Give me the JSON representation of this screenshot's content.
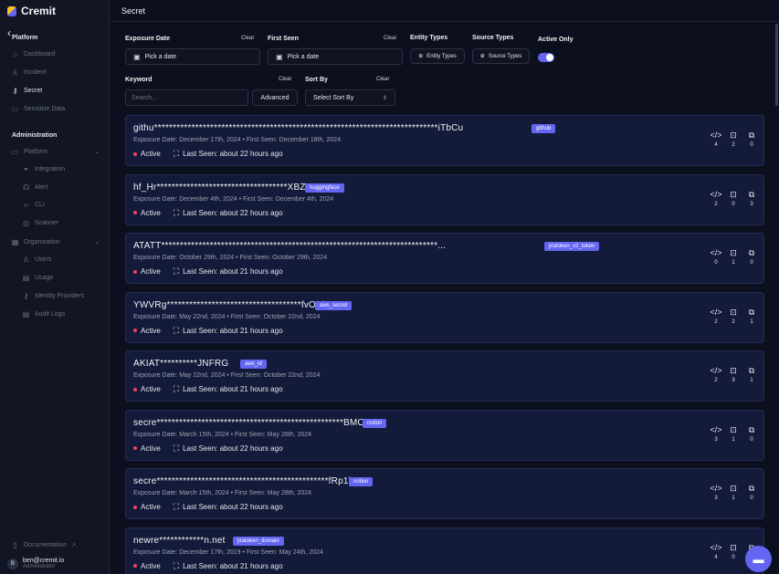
{
  "app": {
    "name": "Cremit",
    "collapse_icon": "chevron-left-icon"
  },
  "sidebar": {
    "platform_title": "Platform",
    "platform_items": [
      {
        "label": "Dashboard",
        "icon": "home-icon"
      },
      {
        "label": "Incident",
        "icon": "bell-icon"
      },
      {
        "label": "Secret",
        "icon": "key-icon",
        "active": true
      },
      {
        "label": "Sensitive Data",
        "icon": "database-icon"
      }
    ],
    "admin_title": "Administration",
    "admin_items": [
      {
        "label": "Platform",
        "icon": "monitor-icon",
        "expandable": true
      },
      {
        "label": "Integration",
        "icon": "link-icon",
        "sub": true
      },
      {
        "label": "Alert",
        "icon": "alert-icon",
        "sub": true
      },
      {
        "label": "CLI",
        "icon": "code-icon",
        "sub": true
      },
      {
        "label": "Scanner",
        "icon": "scanner-icon",
        "sub": true
      },
      {
        "label": "Organization",
        "icon": "building-icon",
        "expandable": true
      },
      {
        "label": "Users",
        "icon": "user-icon",
        "sub": true
      },
      {
        "label": "Usage",
        "icon": "usage-icon",
        "sub": true
      },
      {
        "label": "Identity Providers",
        "icon": "shield-icon",
        "sub": true
      },
      {
        "label": "Audit Logs",
        "icon": "log-icon",
        "sub": true
      }
    ],
    "documentation": "Documentation",
    "user": {
      "initial": "B",
      "email": "ben@cremit.io",
      "role": "Administrator"
    }
  },
  "header": {
    "title": "Secret"
  },
  "filters": {
    "exposure_date": {
      "label": "Exposure Date",
      "clear": "Clear",
      "placeholder": "Pick a date"
    },
    "first_seen": {
      "label": "First Seen",
      "clear": "Clear",
      "placeholder": "Pick a date"
    },
    "entity_types": {
      "label": "Entity Types",
      "button": "Entity Types"
    },
    "source_types": {
      "label": "Source Types",
      "button": "Source Types"
    },
    "active_only": {
      "label": "Active Only",
      "on": true
    },
    "keyword": {
      "label": "Keyword",
      "clear": "Clear",
      "placeholder": "Search..."
    },
    "advanced": "Advanced",
    "sort_by": {
      "label": "Sort By",
      "clear": "Clear",
      "value": "Select Sort By"
    }
  },
  "secrets": [
    {
      "secret": "githu****************************************************************************iTbCu",
      "tag": "github",
      "exposure": "Exposure Date: December 17th, 2024",
      "first_seen": "First Seen: December 18th, 2024",
      "status": "Active",
      "last_seen": "Last Seen: about 22 hours ago",
      "stats": [
        "4",
        "2",
        "0"
      ]
    },
    {
      "secret": "hf_Hr***********************************XBZTG",
      "tag": "huggingface",
      "exposure": "Exposure Date: December 4th, 2024",
      "first_seen": "First Seen: December 4th, 2024",
      "status": "Active",
      "last_seen": "Last Seen: about 22 hours ago",
      "stats": [
        "2",
        "0",
        "3"
      ]
    },
    {
      "secret": "ATATT**************************************************************************...",
      "tag": "jiratoken_v2_token",
      "exposure": "Exposure Date: October 29th, 2024",
      "first_seen": "First Seen: October 29th, 2024",
      "status": "Active",
      "last_seen": "Last Seen: about 21 hours ago",
      "stats": [
        "0",
        "1",
        "0"
      ]
    },
    {
      "secret": "YWVRg************************************fvOKi",
      "tag": "aws_secret",
      "exposure": "Exposure Date: May 22nd, 2024",
      "first_seen": "First Seen: October 22nd, 2024",
      "status": "Active",
      "last_seen": "Last Seen: about 21 hours ago",
      "stats": [
        "2",
        "2",
        "1"
      ]
    },
    {
      "secret": "AKIAT**********JNFRG",
      "tag": "aws_id",
      "exposure": "Exposure Date: May 22nd, 2024",
      "first_seen": "First Seen: October 22nd, 2024",
      "status": "Active",
      "last_seen": "Last Seen: about 21 hours ago",
      "stats": [
        "2",
        "3",
        "1"
      ]
    },
    {
      "secret": "secre**************************************************BMOuE",
      "tag": "notion",
      "exposure": "Exposure Date: March 15th, 2024",
      "first_seen": "First Seen: May 28th, 2024",
      "status": "Active",
      "last_seen": "Last Seen: about 22 hours ago",
      "stats": [
        "3",
        "1",
        "0"
      ]
    },
    {
      "secret": "secre**********************************************fRp1b",
      "tag": "notion",
      "exposure": "Exposure Date: March 15th, 2024",
      "first_seen": "First Seen: May 28th, 2024",
      "status": "Active",
      "last_seen": "Last Seen: about 22 hours ago",
      "stats": [
        "3",
        "1",
        "0"
      ]
    },
    {
      "secret": "newre************n.net",
      "tag": "jiratoken_domain",
      "exposure": "Exposure Date: December 17th, 2019",
      "first_seen": "First Seen: May 24th, 2024",
      "status": "Active",
      "last_seen": "Last Seen: about 21 hours ago",
      "stats": [
        "4",
        "0",
        "0"
      ]
    }
  ],
  "colors": {
    "accent": "#6366f1",
    "active_dot": "#f43f5e",
    "card_bg": "#131a3a"
  }
}
